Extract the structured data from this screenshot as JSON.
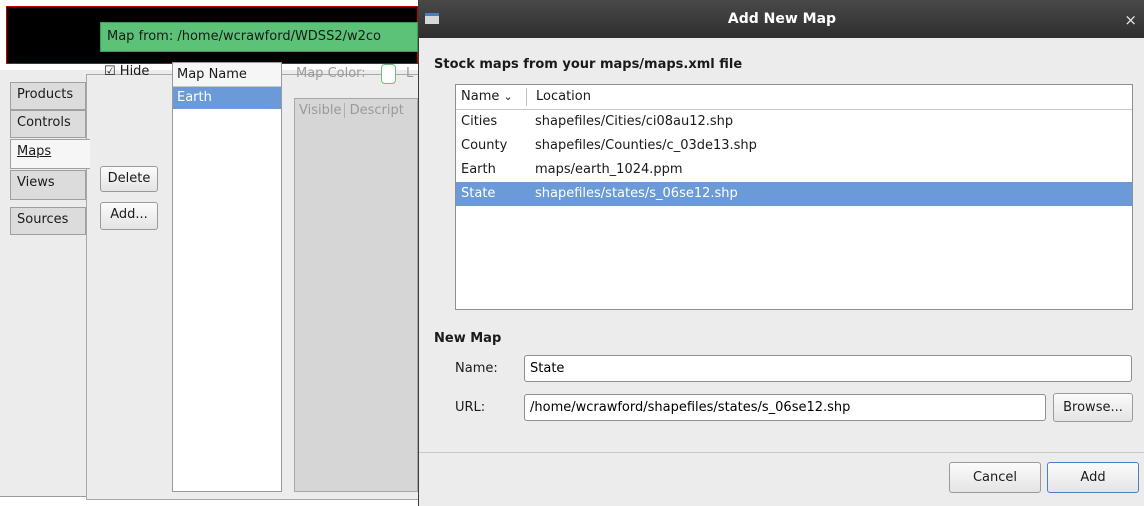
{
  "background_app": {
    "tabs": [
      {
        "label": "Products",
        "active": false
      },
      {
        "label": "Controls",
        "active": false
      },
      {
        "label": "Maps",
        "active": true
      },
      {
        "label": "Views",
        "active": false
      },
      {
        "label": "Sources",
        "active": false
      }
    ],
    "map_from": "Map from: /home/wcrawford/WDSS2/w2co",
    "hide_checkbox": {
      "label": "Hide",
      "checked": true
    },
    "buttons": {
      "delete": "Delete",
      "add": "Add..."
    },
    "map_list": {
      "header": "Map Name",
      "items": [
        "Earth"
      ]
    },
    "map_color_label": "Map Color:",
    "map_color_trailing": "L",
    "layer_table": {
      "columns": [
        "Visible",
        "Descript"
      ]
    }
  },
  "dialog": {
    "title": "Add New Map",
    "stock_heading": "Stock maps from your maps/maps.xml file",
    "columns": {
      "name": "Name",
      "location": "Location"
    },
    "sort_indicator": "chevron-down-icon",
    "stock_maps": [
      {
        "name": "Cities",
        "location": "shapefiles/Cities/ci08au12.shp",
        "selected": false
      },
      {
        "name": "County",
        "location": "shapefiles/Counties/c_03de13.shp",
        "selected": false
      },
      {
        "name": "Earth",
        "location": "maps/earth_1024.ppm",
        "selected": false
      },
      {
        "name": "State",
        "location": "shapefiles/states/s_06se12.shp",
        "selected": true
      }
    ],
    "new_map_heading": "New Map",
    "name_label": "Name:",
    "name_value": "State",
    "url_label": "URL:",
    "url_value": "/home/wcrawford/shapefiles/states/s_06se12.shp",
    "browse_button": "Browse...",
    "cancel_button": "Cancel",
    "add_button": "Add"
  },
  "colors": {
    "selection": "#6a9ad8",
    "map_from_bar": "#5cc277",
    "titlebar": "#2e2e2e"
  }
}
